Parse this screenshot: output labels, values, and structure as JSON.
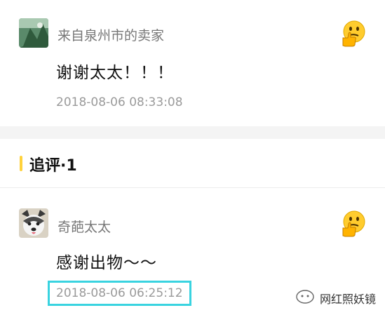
{
  "seller_comment": {
    "username": "来自泉州市的卖家",
    "text": "谢谢太太！！！",
    "time": "2018-08-06 08:33:08",
    "like_emoji": "thumbs-up-thinking-face-icon"
  },
  "followup_section": {
    "title": "追评·1"
  },
  "followup_comment": {
    "username": "奇葩太太",
    "text": "感谢出物～～",
    "time": "2018-08-06 06:25:12",
    "like_emoji": "thumbs-up-thinking-face-icon"
  },
  "watermark": {
    "text": "网红照妖镜",
    "icon": "wechat-official-account-icon"
  },
  "colors": {
    "accent_yellow": "#ffd23c",
    "highlight_cyan": "#39d3e0",
    "divider_gray": "#f4f4f4"
  }
}
